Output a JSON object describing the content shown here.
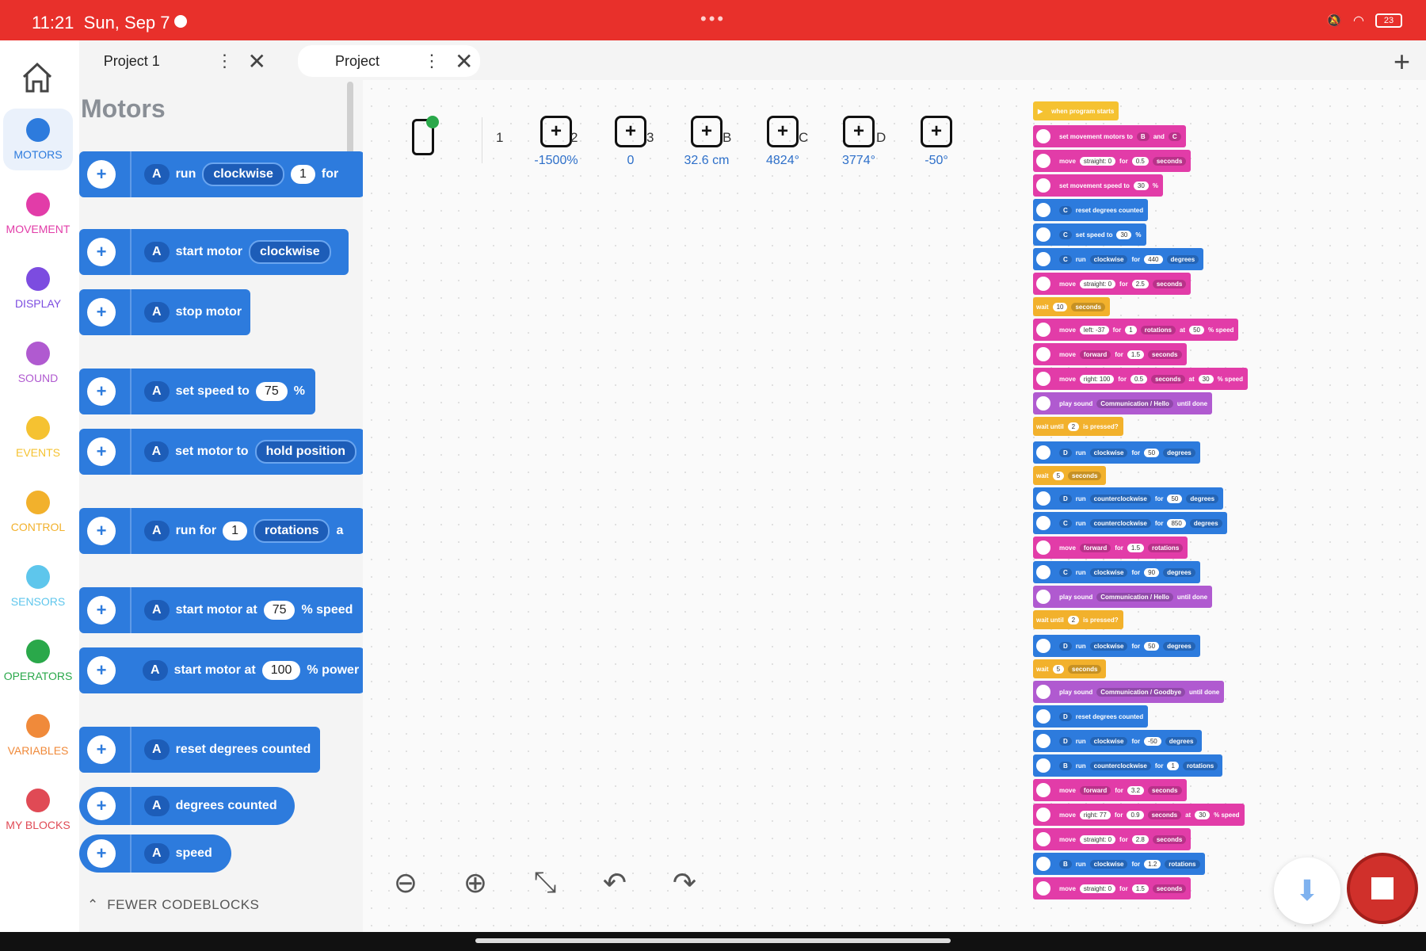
{
  "status": {
    "time": "11:21",
    "date": "Sun, Sep 7",
    "battery": "23"
  },
  "tabs": [
    {
      "label": "Project 1",
      "active": false
    },
    {
      "label": "Project",
      "active": true
    }
  ],
  "nav": {
    "categories": [
      {
        "label": "MOTORS",
        "color": "#2d7bdd"
      },
      {
        "label": "MOVEMENT",
        "color": "#e23ca8"
      },
      {
        "label": "DISPLAY",
        "color": "#7c4ce0"
      },
      {
        "label": "SOUND",
        "color": "#b05ad0"
      },
      {
        "label": "EVENTS",
        "color": "#f5c231"
      },
      {
        "label": "CONTROL",
        "color": "#f2b12c"
      },
      {
        "label": "SENSORS",
        "color": "#5ec6ec"
      },
      {
        "label": "OPERATORS",
        "color": "#2aa84a"
      },
      {
        "label": "VARIABLES",
        "color": "#f08a3a"
      },
      {
        "label": "MY BLOCKS",
        "color": "#e04a55"
      }
    ]
  },
  "palette": {
    "title": "Motors",
    "fewer": "FEWER CODEBLOCKS",
    "blocks": [
      {
        "port": "A",
        "text1": "run",
        "dd1": "clockwise",
        "text2": "for",
        "num1": "1"
      },
      {
        "port": "A",
        "text1": "start motor",
        "dd1": "clockwise"
      },
      {
        "port": "A",
        "text1": "stop motor"
      },
      {
        "port": "A",
        "text1": "set speed to",
        "num1": "75",
        "text2": "%"
      },
      {
        "port": "A",
        "text1": "set motor to",
        "dd1": "hold position"
      },
      {
        "port": "A",
        "text1": "run for",
        "num1": "1",
        "dd1": "rotations",
        "text2": "a"
      },
      {
        "port": "A",
        "text1": "start motor at",
        "num1": "75",
        "text2": "% speed"
      },
      {
        "port": "A",
        "text1": "start motor at",
        "num1": "100",
        "text2": "% power"
      },
      {
        "port": "A",
        "text1": "reset degrees counted"
      },
      {
        "port": "A",
        "text1": "degrees counted"
      },
      {
        "port": "A",
        "text1": "speed"
      }
    ]
  },
  "readouts": [
    {
      "label": "1",
      "value": "-1500%"
    },
    {
      "label": "2",
      "value": "0"
    },
    {
      "label": "3",
      "value": "32.6 cm"
    },
    {
      "label": "B",
      "value": "4824°"
    },
    {
      "label": "C",
      "value": "3774°"
    },
    {
      "label": "D",
      "value": "-50°"
    }
  ],
  "program": [
    {
      "kind": "event",
      "text": "when program starts"
    },
    {
      "kind": "move",
      "text": "set movement motors to",
      "p1": "B",
      "p2": "and",
      "p3": "C"
    },
    {
      "kind": "move",
      "text": "move",
      "p1": "straight: 0",
      "p2": "for",
      "p3": "0.5",
      "p4": "seconds"
    },
    {
      "kind": "move",
      "text": "set movement speed to",
      "p1": "30",
      "p2": "%"
    },
    {
      "kind": "motor",
      "text": "C",
      "p1": "reset degrees counted"
    },
    {
      "kind": "motor",
      "text": "C",
      "p1": "set speed to",
      "p2": "30",
      "p3": "%"
    },
    {
      "kind": "motor",
      "text": "C",
      "p1": "run",
      "p2": "clockwise",
      "p3": "for",
      "p4": "440",
      "p5": "degrees"
    },
    {
      "kind": "move",
      "text": "move",
      "p1": "straight: 0",
      "p2": "for",
      "p3": "2.5",
      "p4": "seconds"
    },
    {
      "kind": "ctrl",
      "text": "wait",
      "p1": "10",
      "p2": "seconds"
    },
    {
      "kind": "move",
      "text": "move",
      "p1": "left: -37",
      "p2": "for",
      "p3": "1",
      "p4": "rotations",
      "p5": "at",
      "p6": "50",
      "p7": "% speed"
    },
    {
      "kind": "move",
      "text": "move",
      "p1": "forward",
      "p2": "for",
      "p3": "1.5",
      "p4": "seconds"
    },
    {
      "kind": "move",
      "text": "move",
      "p1": "right: 100",
      "p2": "for",
      "p3": "0.5",
      "p4": "seconds",
      "p5": "at",
      "p6": "30",
      "p7": "% speed"
    },
    {
      "kind": "sound",
      "text": "play sound",
      "p1": "Communication / Hello",
      "p2": "until done"
    },
    {
      "kind": "ctrl",
      "text": "wait until",
      "p1": "2",
      "p2": "is pressed?"
    },
    {
      "kind": "motor",
      "text": "D",
      "p1": "run",
      "p2": "clockwise",
      "p3": "for",
      "p4": "50",
      "p5": "degrees"
    },
    {
      "kind": "ctrl",
      "text": "wait",
      "p1": "5",
      "p2": "seconds"
    },
    {
      "kind": "motor",
      "text": "D",
      "p1": "run",
      "p2": "counterclockwise",
      "p3": "for",
      "p4": "50",
      "p5": "degrees"
    },
    {
      "kind": "motor",
      "text": "C",
      "p1": "run",
      "p2": "counterclockwise",
      "p3": "for",
      "p4": "850",
      "p5": "degrees"
    },
    {
      "kind": "move",
      "text": "move",
      "p1": "forward",
      "p2": "for",
      "p3": "1.5",
      "p4": "rotations"
    },
    {
      "kind": "motor",
      "text": "C",
      "p1": "run",
      "p2": "clockwise",
      "p3": "for",
      "p4": "90",
      "p5": "degrees"
    },
    {
      "kind": "sound",
      "text": "play sound",
      "p1": "Communication / Hello",
      "p2": "until done"
    },
    {
      "kind": "ctrl",
      "text": "wait until",
      "p1": "2",
      "p2": "is pressed?"
    },
    {
      "kind": "motor",
      "text": "D",
      "p1": "run",
      "p2": "clockwise",
      "p3": "for",
      "p4": "50",
      "p5": "degrees"
    },
    {
      "kind": "ctrl",
      "text": "wait",
      "p1": "5",
      "p2": "seconds"
    },
    {
      "kind": "sound",
      "text": "play sound",
      "p1": "Communication / Goodbye",
      "p2": "until done"
    },
    {
      "kind": "motor",
      "text": "D",
      "p1": "reset degrees counted"
    },
    {
      "kind": "motor",
      "text": "D",
      "p1": "run",
      "p2": "clockwise",
      "p3": "for",
      "p4": "-50",
      "p5": "degrees"
    },
    {
      "kind": "motor",
      "text": "B",
      "p1": "run",
      "p2": "counterclockwise",
      "p3": "for",
      "p4": "1",
      "p5": "rotations"
    },
    {
      "kind": "move",
      "text": "move",
      "p1": "forward",
      "p2": "for",
      "p3": "3.2",
      "p4": "seconds"
    },
    {
      "kind": "move",
      "text": "move",
      "p1": "right: 77",
      "p2": "for",
      "p3": "0.9",
      "p4": "seconds",
      "p5": "at",
      "p6": "30",
      "p7": "% speed"
    },
    {
      "kind": "move",
      "text": "move",
      "p1": "straight: 0",
      "p2": "for",
      "p3": "2.8",
      "p4": "seconds"
    },
    {
      "kind": "motor",
      "text": "B",
      "p1": "run",
      "p2": "clockwise",
      "p3": "for",
      "p4": "1.2",
      "p5": "rotations"
    },
    {
      "kind": "move",
      "text": "move",
      "p1": "straight: 0",
      "p2": "for",
      "p3": "1.5",
      "p4": "seconds"
    }
  ]
}
